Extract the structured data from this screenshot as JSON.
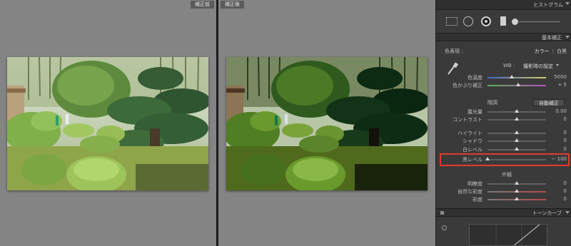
{
  "before": {
    "label": "補正前"
  },
  "after": {
    "label": "補正後"
  },
  "panel": {
    "histogram_title": "ヒストグラム",
    "basic_section_title": "基本補正",
    "treatment": {
      "label": "色表現 :",
      "color": "カラー",
      "bw": "白黒",
      "selected": "カラー"
    },
    "wb": {
      "label": "WB :",
      "value": "撮影時の設定"
    },
    "temp": {
      "label": "色温度",
      "value": "5000",
      "position": 0.42
    },
    "tint": {
      "label": "色かぶり補正",
      "value": "+ 5",
      "position": 0.52
    },
    "tone": {
      "label": "階調",
      "auto_button": "自動補正"
    },
    "exposure": {
      "label": "露光量",
      "value": "0.00",
      "position": 0.5
    },
    "contrast": {
      "label": "コントラスト",
      "value": "0",
      "position": 0.5
    },
    "highlights": {
      "label": "ハイライト",
      "value": "0",
      "position": 0.5
    },
    "shadows": {
      "label": "シャドウ",
      "value": "0",
      "position": 0.5
    },
    "whites": {
      "label": "白レベル",
      "value": "0",
      "position": 0.5
    },
    "blacks": {
      "label": "黒レベル",
      "value": "− 100",
      "position": 0.0
    },
    "presence": {
      "label": "外観"
    },
    "clarity": {
      "label": "明瞭度",
      "value": "0",
      "position": 0.5
    },
    "vibrance": {
      "label": "自然な彩度",
      "value": "0",
      "position": 0.5
    },
    "saturation": {
      "label": "彩度",
      "value": "0",
      "position": 0.5
    },
    "tone_curve_title": "トーンカーブ"
  },
  "icons": {
    "crop": "crop-overlay-icon",
    "spot": "spot-removal-icon",
    "redeye": "red-eye-icon",
    "graduated": "graduated-filter-icon",
    "brush": "adjustment-brush-icon"
  },
  "colors": {
    "highlight_box": "#e23a2a",
    "accent": "#d8d8d8"
  }
}
